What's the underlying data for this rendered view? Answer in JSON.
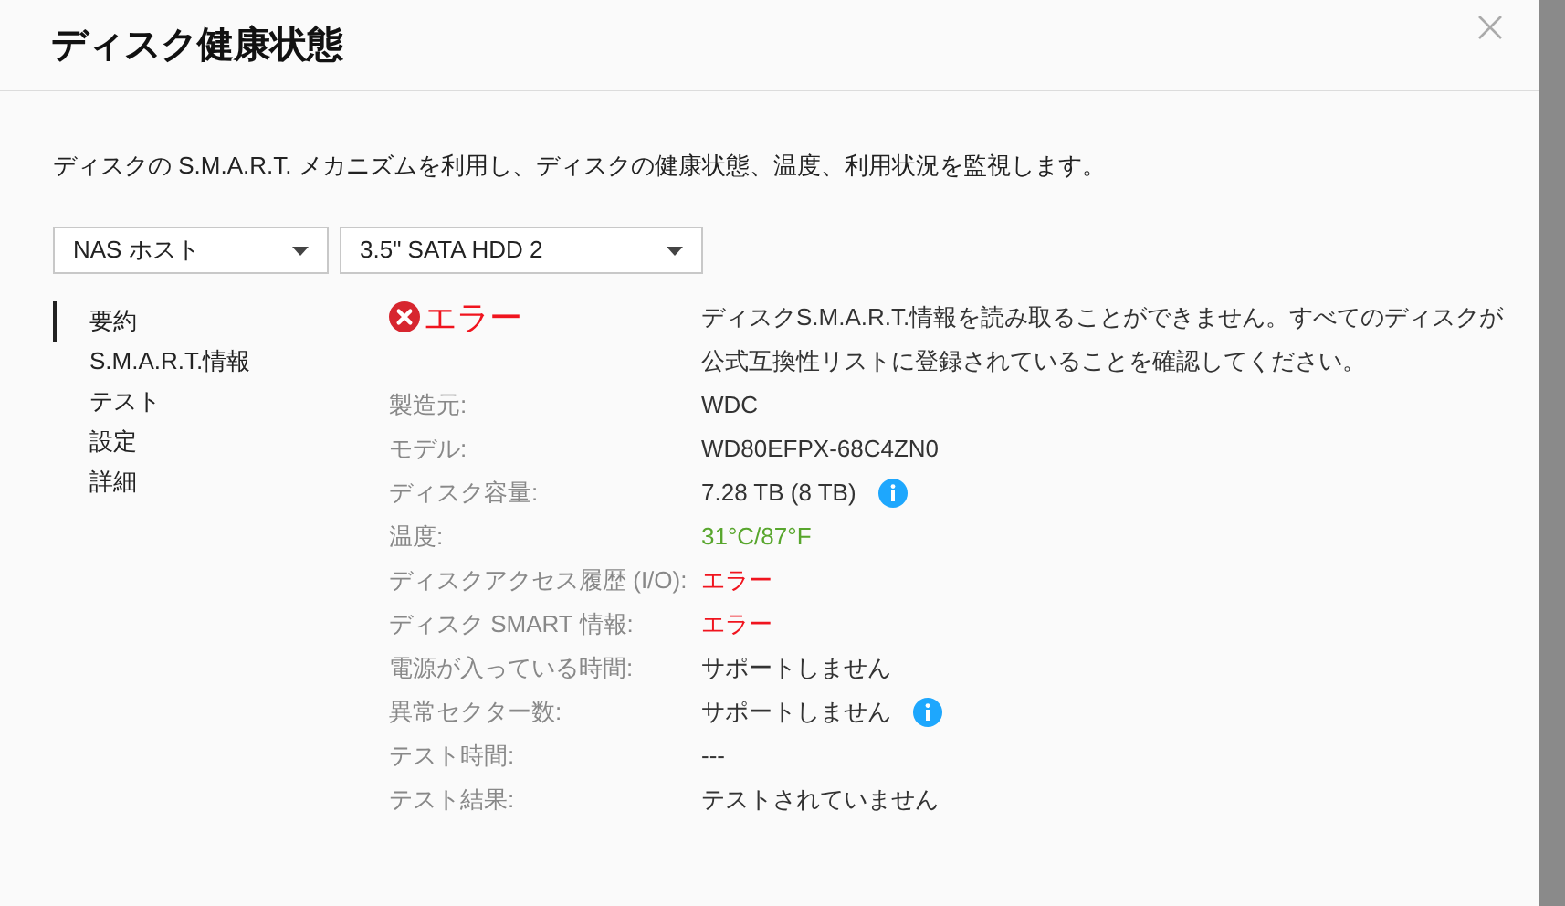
{
  "dialog": {
    "title": "ディスク健康状態",
    "description": "ディスクの S.M.A.R.T. メカニズムを利用し、ディスクの健康状態、温度、利用状況を監視します。"
  },
  "selects": [
    {
      "value": "NAS ホスト"
    },
    {
      "value": "3.5\" SATA HDD 2"
    }
  ],
  "nav": [
    {
      "label": "要約",
      "selected": true
    },
    {
      "label": "S.M.A.R.T.情報",
      "selected": false
    },
    {
      "label": "テスト",
      "selected": false
    },
    {
      "label": "設定",
      "selected": false
    },
    {
      "label": "詳細",
      "selected": false
    }
  ],
  "status": {
    "kind": "error",
    "label": "エラー",
    "message": "ディスクS.M.A.R.T.情報を読み取ることができません。すべてのディスクが公式互換性リストに登録されていることを確認してください。"
  },
  "details": [
    {
      "label": "製造元:",
      "value": "WDC",
      "kind": "normal",
      "info": false
    },
    {
      "label": "モデル:",
      "value": "WD80EFPX-68C4ZN0",
      "kind": "normal",
      "info": false
    },
    {
      "label": "ディスク容量:",
      "value": "7.28 TB (8 TB)",
      "kind": "normal",
      "info": true
    },
    {
      "label": "温度:",
      "value": "31°C/87°F",
      "kind": "good",
      "info": false
    },
    {
      "label": "ディスクアクセス履歴 (I/O):",
      "value": "エラー",
      "kind": "error",
      "info": false
    },
    {
      "label": "ディスク SMART 情報:",
      "value": "エラー",
      "kind": "error",
      "info": false
    },
    {
      "label": "電源が入っている時間:",
      "value": "サポートしません",
      "kind": "normal",
      "info": false
    },
    {
      "label": "異常セクター数:",
      "value": "サポートしません",
      "kind": "normal",
      "info": true
    },
    {
      "label": "テスト時間:",
      "value": "---",
      "kind": "normal",
      "info": false
    },
    {
      "label": "テスト結果:",
      "value": "テストされていません",
      "kind": "normal",
      "info": false
    }
  ]
}
